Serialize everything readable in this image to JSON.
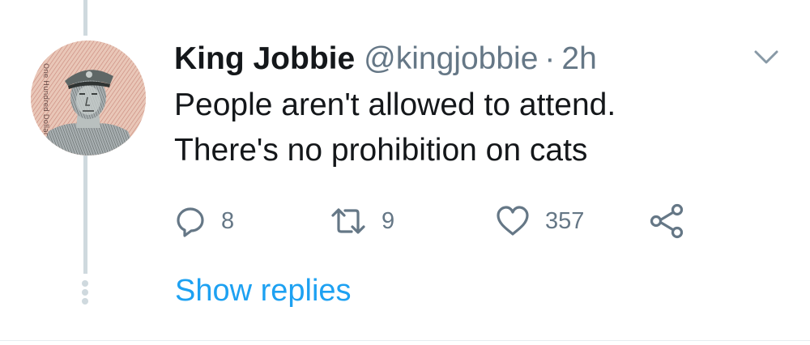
{
  "tweet": {
    "display_name": "King Jobbie",
    "handle": "@kingjobbie",
    "separator": "·",
    "time": "2h",
    "text_lines": [
      "People aren't allowed to attend.",
      "There's no prohibition on cats"
    ],
    "avatar_text": "One Hundred Dollar",
    "actions": {
      "reply_count": "8",
      "retweet_count": "9",
      "like_count": "357"
    },
    "show_replies_label": "Show replies"
  },
  "icons": {
    "reply": "reply-icon",
    "retweet": "retweet-icon",
    "like": "heart-icon",
    "share": "share-icon",
    "more": "chevron-down-icon"
  },
  "colors": {
    "text_primary": "#14171a",
    "text_secondary": "#657786",
    "link": "#1da1f2",
    "thread_line": "#cfd9de"
  }
}
